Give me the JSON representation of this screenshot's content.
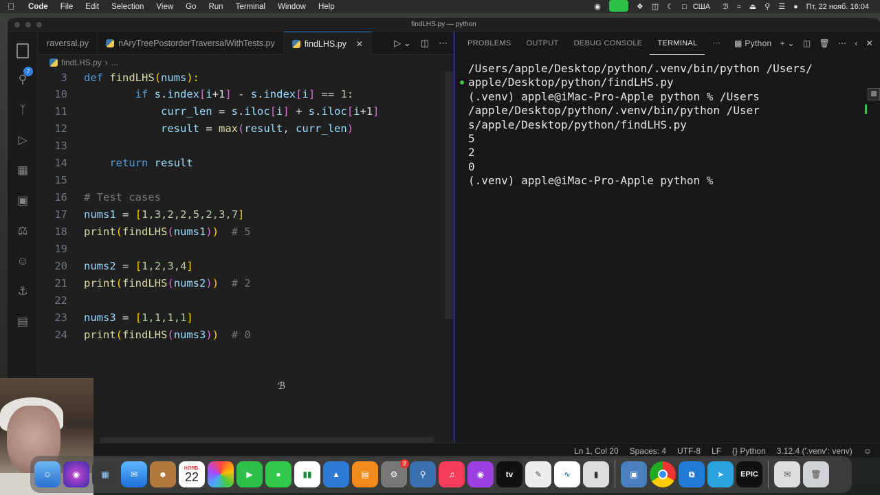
{
  "menubar": {
    "app": "Code",
    "items": [
      "File",
      "Edit",
      "Selection",
      "View",
      "Go",
      "Run",
      "Terminal",
      "Window",
      "Help"
    ],
    "input_source": "США",
    "datetime": "Пт, 22 нояб.  16:04"
  },
  "window": {
    "title": "findLHS.py — python"
  },
  "activity": {
    "badge": "7"
  },
  "tabs": [
    {
      "label": "raversal.py"
    },
    {
      "label": "nAryTreePostorderTraversalWithTests.py"
    },
    {
      "label": "findLHS.py"
    }
  ],
  "breadcrumb": {
    "file": "findLHS.py",
    "more": "..."
  },
  "code": {
    "lines": [
      {
        "n": "3"
      },
      {
        "n": "10"
      },
      {
        "n": "11"
      },
      {
        "n": "12"
      },
      {
        "n": "13"
      },
      {
        "n": "14"
      },
      {
        "n": "15"
      },
      {
        "n": "16"
      },
      {
        "n": "17"
      },
      {
        "n": "18"
      },
      {
        "n": "19"
      },
      {
        "n": "20"
      },
      {
        "n": "21"
      },
      {
        "n": "22"
      },
      {
        "n": "23"
      },
      {
        "n": "24"
      }
    ],
    "t": {
      "def": "def",
      "findLHS": "findLHS",
      "nums": "nums",
      "paren_open": "(",
      "paren_close": "):",
      "if": "if",
      "s": "s",
      "index": "index",
      "i": "i",
      "plus1": "+1",
      "minus": "-",
      "eqeq": "==",
      "one": "1",
      "colon": ":",
      "curr_len": "curr_len",
      "eq": "=",
      "iloc": "iloc",
      "plus": "+",
      "result": "result",
      "max": "max",
      "comma": ",",
      "return": "return",
      "comment_test": "# Test cases",
      "nums1": "nums1",
      "list1": "1,3,2,2,5,2,3,7",
      "print": "print",
      "c5": "# 5",
      "nums2": "nums2",
      "list2": "1,2,3,4",
      "c2": "# 2",
      "nums3": "nums3",
      "list3": "1,1,1,1",
      "c0": "# 0"
    }
  },
  "panel": {
    "tabs": [
      "PROBLEMS",
      "OUTPUT",
      "DEBUG CONSOLE",
      "TERMINAL"
    ],
    "shell": "Python",
    "terminal": [
      "/Users/apple/Desktop/python/.venv/bin/python /Users/",
      "apple/Desktop/python/findLHS.py",
      "(.venv) apple@iMac-Pro-Apple python % /Users",
      "/apple/Desktop/python/.venv/bin/python /User",
      "s/apple/Desktop/python/findLHS.py",
      "5",
      "2",
      "0",
      "(.venv) apple@iMac-Pro-Apple python % "
    ]
  },
  "status": {
    "position": "Ln 1, Col 20",
    "spaces": "Spaces: 4",
    "encoding": "UTF-8",
    "eol": "LF",
    "language": "{} Python",
    "interpreter": "3.12.4 ('.venv': venv)"
  },
  "dock": {
    "calendar_month": "НОЯБ.",
    "calendar_day": "22",
    "settings_badge": "2",
    "epic": "EPIC"
  }
}
